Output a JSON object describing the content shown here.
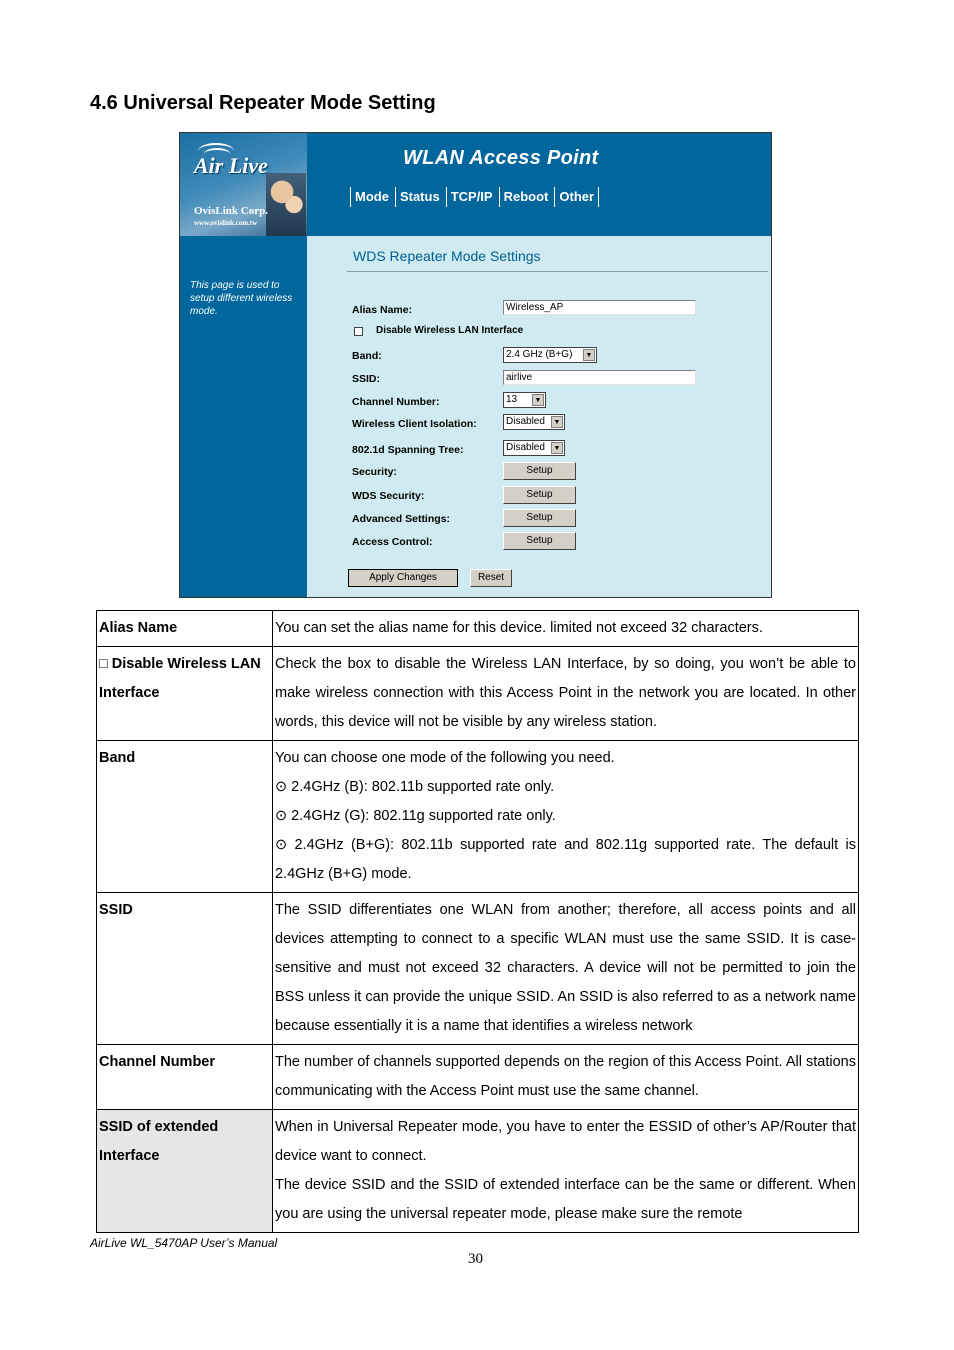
{
  "document": {
    "heading": "4.6 Universal Repeater Mode Setting",
    "footer": "AirLive WL_5470AP User’s Manual",
    "page_number": "30"
  },
  "screenshot": {
    "logo": {
      "brand": "Air Live",
      "corp": "OvisLink Corp.",
      "url": "www.ovislink.com.tw"
    },
    "app_title": "WLAN Access Point",
    "nav": [
      "Mode",
      "Status",
      "TCP/IP",
      "Reboot",
      "Other"
    ],
    "sidebar_text": "This page is used to setup different wireless mode.",
    "page_title": "WDS Repeater Mode Settings",
    "form": {
      "alias_label": "Alias Name:",
      "alias_value": "Wireless_AP",
      "disable_label": "Disable Wireless LAN Interface",
      "disable_checked": false,
      "band_label": "Band:",
      "band_value": "2.4 GHz (B+G)",
      "ssid_label": "SSID:",
      "ssid_value": "airlive",
      "channel_label": "Channel Number:",
      "channel_value": "13",
      "isolation_label": "Wireless Client Isolation:",
      "isolation_value": "Disabled",
      "spanning_label": "802.1d Spanning Tree:",
      "spanning_value": "Disabled",
      "security_label": "Security:",
      "wds_security_label": "WDS Security:",
      "advanced_label": "Advanced Settings:",
      "access_label": "Access Control:",
      "setup_label": "Setup",
      "apply_label": "Apply Changes",
      "reset_label": "Reset"
    },
    "colors": {
      "header_blue": "#00669c",
      "content_bg": "#cfeaf0"
    }
  },
  "table": [
    {
      "key": "Alias Name",
      "lines": [
        "You can set the alias name for this device. limited not exceed 32 characters."
      ]
    },
    {
      "key": "□ Disable Wireless LAN Interface",
      "lines": [
        "Check the box to disable the Wireless LAN Interface, by so doing, you won’t be able to make wireless connection with this Access Point in the network you are located. In other words, this device will not be visible by any wireless station."
      ]
    },
    {
      "key": "Band",
      "lines": [
        "You can choose one mode of the following you need.",
        "⊙ 2.4GHz (B): 802.11b supported rate only.",
        "⊙ 2.4GHz (G): 802.11g supported rate only.",
        "⊙ 2.4GHz (B+G): 802.11b supported rate and 802.11g supported rate. The default is 2.4GHz (B+G) mode."
      ]
    },
    {
      "key": "SSID",
      "lines": [
        "The SSID differentiates one WLAN from another; therefore, all access points and all devices attempting to connect to a specific WLAN must use the same SSID. It is case-sensitive and must not exceed 32 characters. A device will not be permitted to join the BSS unless it can provide the unique SSID. An SSID is also referred to as a network name because essentially it is a name that identifies a wireless network"
      ]
    },
    {
      "key": "Channel Number",
      "lines": [
        "The number of channels supported depends on the region of this Access Point. All stations communicating with the Access Point must use the same channel."
      ]
    },
    {
      "key": "SSID of extended Interface",
      "lines": [
        "When in Universal Repeater mode, you have to enter the ESSID of other’s AP/Router that device want to connect.",
        "The device SSID and the SSID of extended interface can be the same or different. When you are using the universal repeater mode, please make sure the remote"
      ]
    }
  ]
}
